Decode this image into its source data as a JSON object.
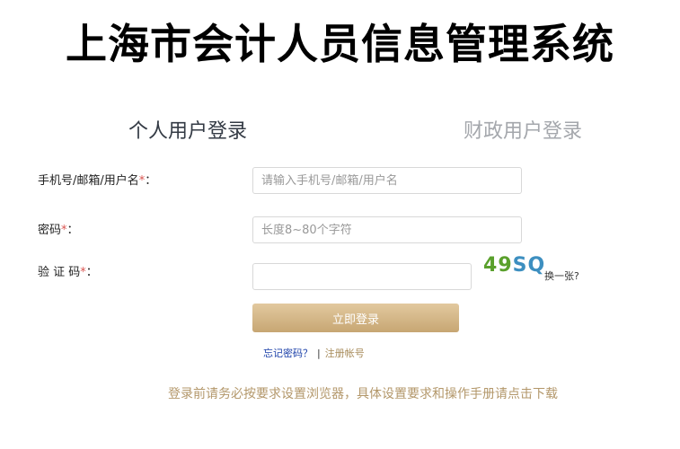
{
  "title": "上海市会计人员信息管理系统",
  "tabs": {
    "personal": "个人用户登录",
    "finance": "财政用户登录"
  },
  "form": {
    "username_label": "手机号/邮箱/用户名",
    "username_placeholder": "请输入手机号/邮箱/用户名",
    "password_label": "密码",
    "password_placeholder": "长度8~80个字符",
    "captcha_label": "验 证 码",
    "required_mark": "*",
    "label_colon": "：",
    "captcha_value": ""
  },
  "captcha": {
    "chars": [
      "4",
      "9",
      "S",
      "Q"
    ],
    "refresh_label": "换一张?"
  },
  "login_button": "立即登录",
  "links": {
    "forgot": "忘记密码？",
    "separator": "|",
    "register": "注册帐号"
  },
  "notice": "登录前请务必按要求设置浏览器，具体设置要求和操作手册请点击下载",
  "colors": {
    "accent": "#c7a673",
    "notice": "#b3976a",
    "required": "#d9534f"
  }
}
